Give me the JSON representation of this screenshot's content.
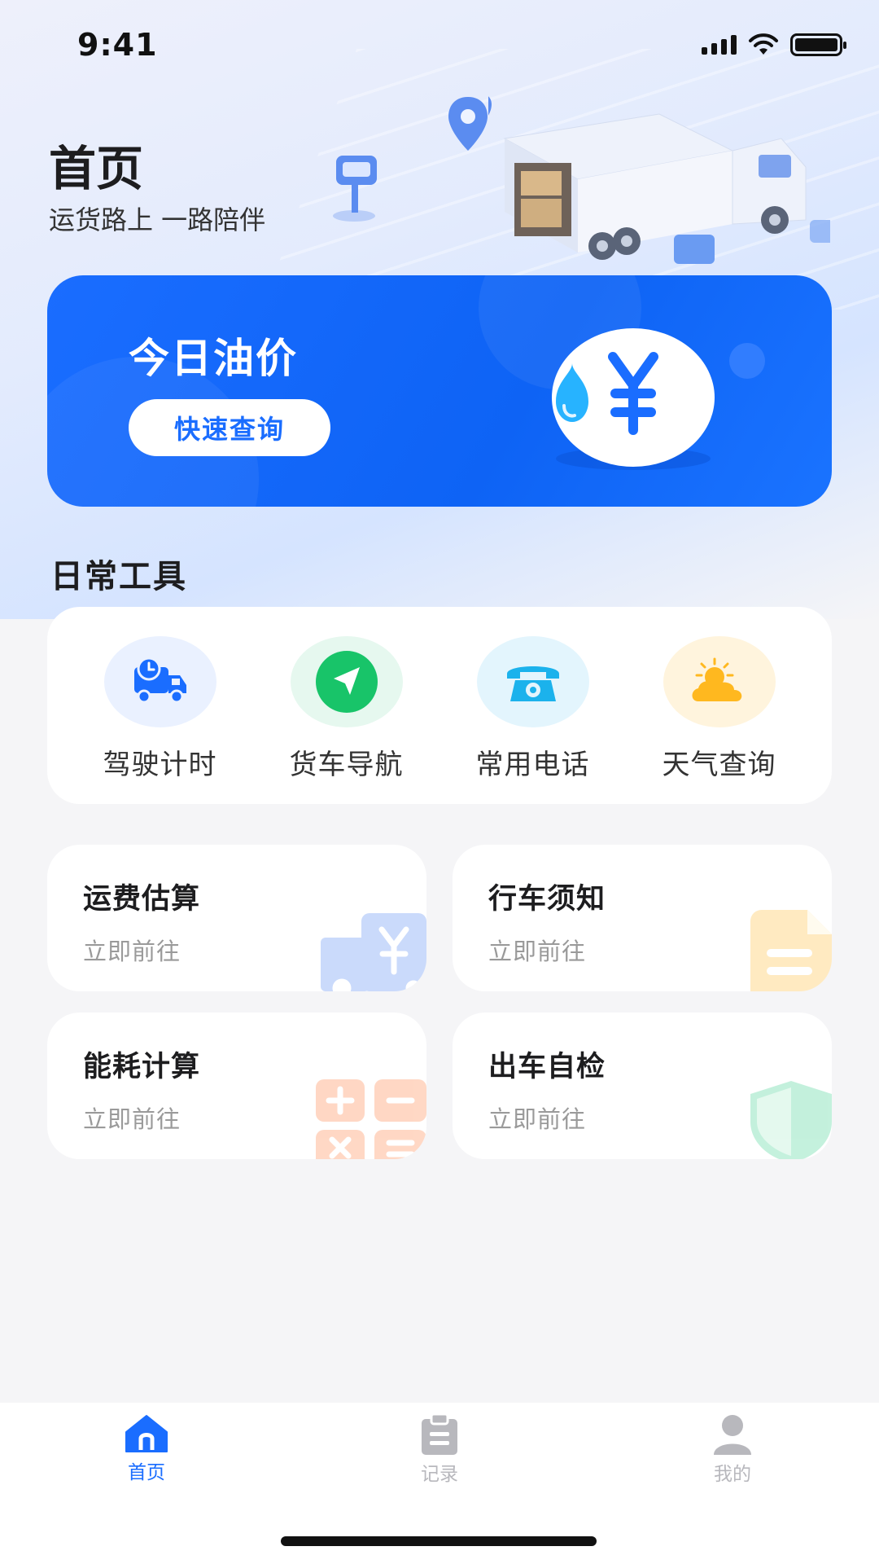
{
  "status_bar": {
    "time": "9:41"
  },
  "header": {
    "title": "首页",
    "subtitle": "运货路上 一路陪伴"
  },
  "oil_card": {
    "title": "今日油价",
    "button_label": "快速查询"
  },
  "tools": {
    "section_title": "日常工具",
    "items": [
      {
        "label": "驾驶计时",
        "icon": "truck-clock-icon",
        "bg": "#eaf1ff",
        "color": "#1a6dff"
      },
      {
        "label": "货车导航",
        "icon": "navigation-arrow-icon",
        "bg": "#e6f8ef",
        "color": "#18c469"
      },
      {
        "label": "常用电话",
        "icon": "telephone-icon",
        "bg": "#e3f5fd",
        "color": "#1bb2ec"
      },
      {
        "label": "天气查询",
        "icon": "weather-sun-cloud-icon",
        "bg": "#fff4dd",
        "color": "#ffb81f"
      }
    ]
  },
  "features": [
    {
      "title": "运费估算",
      "subtitle": "立即前往",
      "icon": "freight-yen-icon"
    },
    {
      "title": "行车须知",
      "subtitle": "立即前往",
      "icon": "document-icon"
    },
    {
      "title": "能耗计算",
      "subtitle": "立即前往",
      "icon": "calculator-icon"
    },
    {
      "title": "出车自检",
      "subtitle": "立即前往",
      "icon": "shield-icon"
    }
  ],
  "tabbar": {
    "items": [
      {
        "label": "首页",
        "icon": "home-icon",
        "active": true
      },
      {
        "label": "记录",
        "icon": "clipboard-icon",
        "active": false
      },
      {
        "label": "我的",
        "icon": "user-icon",
        "active": false
      }
    ],
    "active_color": "#1a6dff",
    "inactive_color": "#b8b8bd"
  }
}
